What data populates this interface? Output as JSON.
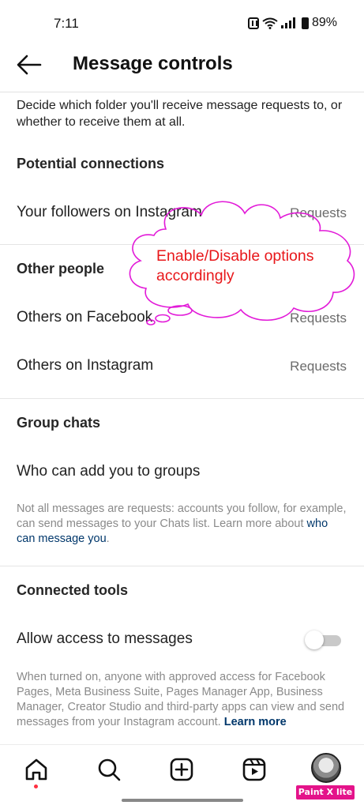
{
  "status_bar": {
    "time": "7:11",
    "battery": "89%"
  },
  "header": {
    "title": "Message controls"
  },
  "intro": "Decide which folder you'll receive message requests to, or whether to receive them at all.",
  "sections": {
    "potential": {
      "title": "Potential connections",
      "rows": [
        {
          "label": "Your followers on Instagram",
          "value": "Requests"
        }
      ]
    },
    "other_people": {
      "title": "Other people",
      "rows": [
        {
          "label": "Others on Facebook",
          "value": "Requests"
        },
        {
          "label": "Others on Instagram",
          "value": "Requests"
        }
      ]
    },
    "group_chats": {
      "title": "Group chats",
      "rows": [
        {
          "label": "Who can add you to groups"
        }
      ],
      "note_prefix": "Not all messages are requests: accounts you follow, for example, can send messages to your Chats list. Learn more about ",
      "note_link": "who can message you",
      "note_suffix": "."
    },
    "connected_tools": {
      "title": "Connected tools",
      "rows": [
        {
          "label": "Allow access to messages",
          "toggle_on": false
        }
      ],
      "note_prefix": "When turned on, anyone with approved access for Facebook Pages, Meta Business Suite, Pages Manager App, Business Manager, Creator Studio and third-party apps can view and send messages from your Instagram account. ",
      "note_link": "Learn more"
    }
  },
  "annotation": {
    "line1": "Enable/Disable options",
    "line2": "accordingly",
    "color": "#e8171a",
    "outline_color": "#e21ad8"
  },
  "bottom_nav": {
    "icons": [
      "home-icon",
      "search-icon",
      "create-icon",
      "reels-icon",
      "profile-avatar"
    ]
  },
  "watermark": "Paint X lite",
  "colors": {
    "link": "#00376b",
    "secondary_text": "#6b6b6b",
    "notification_dot": "#ff3040"
  }
}
